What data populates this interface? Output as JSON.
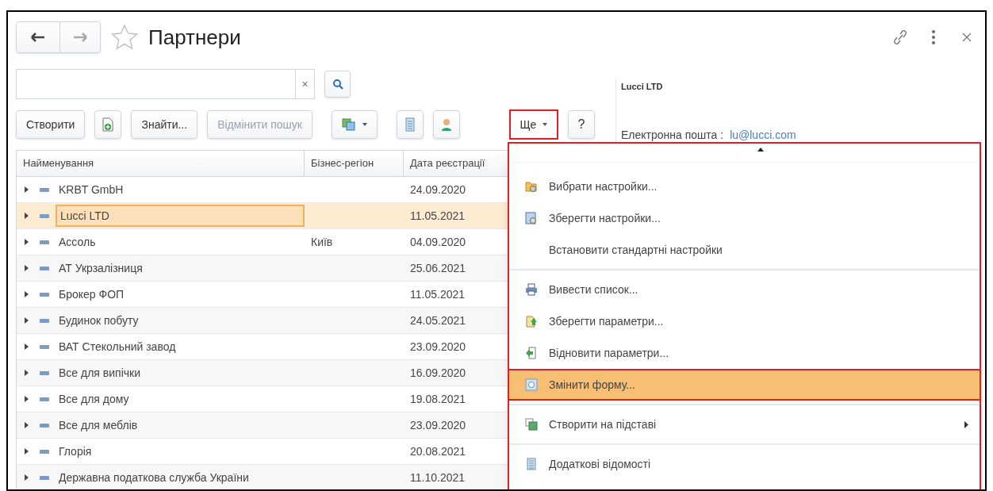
{
  "title": "Партнери",
  "favorite": false,
  "search": {
    "clear": "×"
  },
  "toolbar": [
    {
      "kind": "text",
      "label": "Створити",
      "disabled": false
    },
    {
      "kind": "add-icon"
    },
    {
      "kind": "text",
      "label": "Знайти...",
      "disabled": false
    },
    {
      "kind": "text",
      "label": "Відмінити пошук",
      "disabled": true
    },
    {
      "kind": "dropdown-icon"
    },
    {
      "kind": "list-icon"
    },
    {
      "kind": "person-icon"
    }
  ],
  "more_button": {
    "label": "Ще",
    "highlighted": true
  },
  "help_button": {
    "label": "?"
  },
  "table": {
    "columns": [
      "Найменування",
      "Бізнес-регіон",
      "Дата реєстрації"
    ],
    "rows": [
      {
        "name": "KRBT GmbH",
        "region": "",
        "date": "24.09.2020",
        "selected": false
      },
      {
        "name": "Lucci LTD",
        "region": "",
        "date": "11.05.2021",
        "selected": true
      },
      {
        "name": "Ассоль",
        "region": "Київ",
        "date": "04.09.2020",
        "selected": false
      },
      {
        "name": "АТ Укрзалізниця",
        "region": "",
        "date": "25.06.2021",
        "selected": false
      },
      {
        "name": "Брокер ФОП",
        "region": "",
        "date": "11.05.2021",
        "selected": false
      },
      {
        "name": "Будинок побуту",
        "region": "",
        "date": "24.05.2021",
        "selected": false
      },
      {
        "name": "ВАТ Стекольний завод",
        "region": "",
        "date": "23.09.2020",
        "selected": false
      },
      {
        "name": "Все для випічки",
        "region": "",
        "date": "16.09.2020",
        "selected": false
      },
      {
        "name": "Все для дому",
        "region": "",
        "date": "19.08.2021",
        "selected": false
      },
      {
        "name": "Все для меблів",
        "region": "",
        "date": "23.09.2020",
        "selected": false
      },
      {
        "name": "Глорія",
        "region": "",
        "date": "20.08.2021",
        "selected": false
      },
      {
        "name": "Державна податкова служба України",
        "region": "",
        "date": "11.10.2021",
        "selected": false
      }
    ]
  },
  "detail": {
    "name": "Lucci LTD",
    "email_label": "Електронна пошта :",
    "email": "lu@lucci.com"
  },
  "menu": {
    "groups": [
      [
        {
          "label": "Вибрати настройки...",
          "selected": false,
          "submenu": false
        },
        {
          "label": "Зберегти настройки...",
          "selected": false,
          "submenu": false
        },
        {
          "label": "Встановити стандартні настройки",
          "selected": false,
          "submenu": false
        }
      ],
      [
        {
          "label": "Вивести список...",
          "selected": false,
          "submenu": false
        },
        {
          "label": "Зберегти параметри...",
          "selected": false,
          "submenu": false
        },
        {
          "label": "Відновити параметри...",
          "selected": false,
          "submenu": false
        },
        {
          "label": "Змінити форму...",
          "selected": true,
          "submenu": false
        }
      ],
      [
        {
          "label": "Створити на підставі",
          "selected": false,
          "submenu": true
        }
      ],
      [
        {
          "label": "Додаткові відомості",
          "selected": false,
          "submenu": false
        }
      ]
    ]
  }
}
